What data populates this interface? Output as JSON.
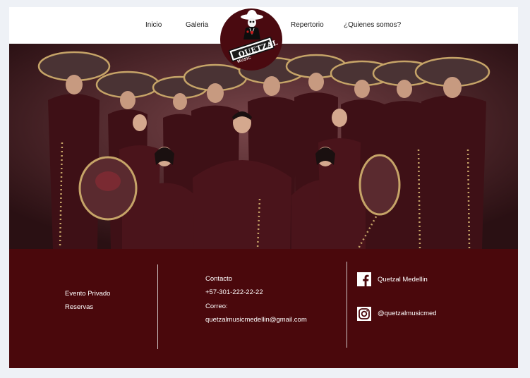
{
  "nav": {
    "items": [
      "Inicio",
      "Galeria",
      "Repertorio",
      "¿Quienes somos?"
    ]
  },
  "logo": {
    "text": "QUETZAL",
    "subtext": "MUSIC"
  },
  "footer": {
    "col1": [
      "Evento Privado",
      "Reservas"
    ],
    "contact": {
      "heading": "Contacto",
      "phone": "+57-301-222-22-22",
      "email_label": "Correo:",
      "email": "quetzalmusicmedellin@gmail.com"
    },
    "social": [
      {
        "icon": "facebook-icon",
        "label": "Quetzal Medellin"
      },
      {
        "icon": "instagram-icon",
        "label": "@quetzalmusicmed"
      }
    ]
  },
  "colors": {
    "accent": "#4a080c",
    "hero_bg": "#4a2428",
    "suit": "#3e1016",
    "gold": "#c6a468"
  }
}
